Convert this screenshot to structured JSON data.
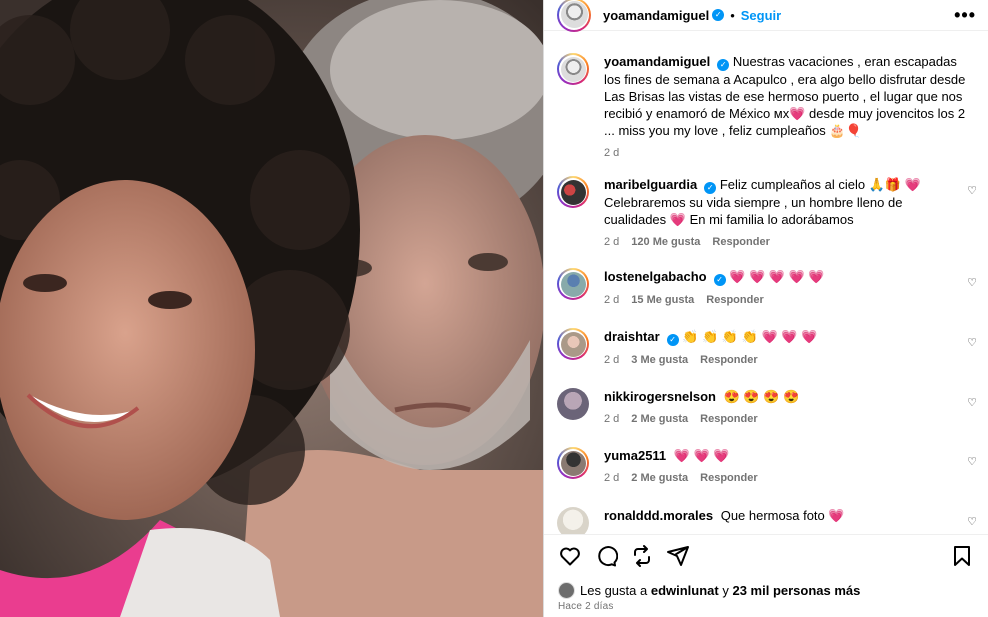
{
  "post": {
    "username": "yoamandamiguel",
    "follow_label": "Seguir",
    "more_label": "•••",
    "dot": "•"
  },
  "caption": {
    "username": "yoamandamiguel",
    "text": "Nuestras vacaciones , eran escapadas los fines de semana a Acapulco , era algo bello disfrutar desde Las Brisas las vistas de ese hermoso puerto , el lugar que nos recibió y enamoró de México ᴍx💗 desde muy jovencitos los 2 ... miss you my love , feliz cumpleaños 🎂🎈",
    "time": "2 d"
  },
  "comments": [
    {
      "username": "maribelguardia",
      "verified": true,
      "text": "Feliz cumpleaños al cielo 🙏🎁 💗 Celebraremos su vida siempre , un hombre lleno de cualidades 💗 En mi familia lo adorábamos",
      "time": "2 d",
      "likes": "120 Me gusta",
      "reply": "Responder"
    },
    {
      "username": "lostenelgabacho",
      "verified": true,
      "text": "💗 💗 💗 💗 💗",
      "time": "2 d",
      "likes": "15 Me gusta",
      "reply": "Responder"
    },
    {
      "username": "draishtar",
      "verified": true,
      "text": "👏 👏 👏 👏 💗 💗 💗",
      "time": "2 d",
      "likes": "3 Me gusta",
      "reply": "Responder"
    },
    {
      "username": "nikkirogersnelson",
      "verified": false,
      "text": "😍 😍 😍 😍",
      "time": "2 d",
      "likes": "2 Me gusta",
      "reply": "Responder"
    },
    {
      "username": "yuma2511",
      "verified": false,
      "text": "💗 💗 💗",
      "time": "2 d",
      "likes": "2 Me gusta",
      "reply": "Responder"
    },
    {
      "username": "ronalddd.morales",
      "verified": false,
      "text": "Que hermosa foto 💗",
      "time": "",
      "likes": "",
      "reply": ""
    }
  ],
  "likes_line": {
    "prefix": "Les gusta a",
    "user": "edwinlunat",
    "middle": "y",
    "count": "23 mil personas más"
  },
  "ago": "Hace 2 días",
  "colors": {
    "accent": "#0095f6",
    "heart": "#e8265e",
    "muted": "#737373"
  }
}
